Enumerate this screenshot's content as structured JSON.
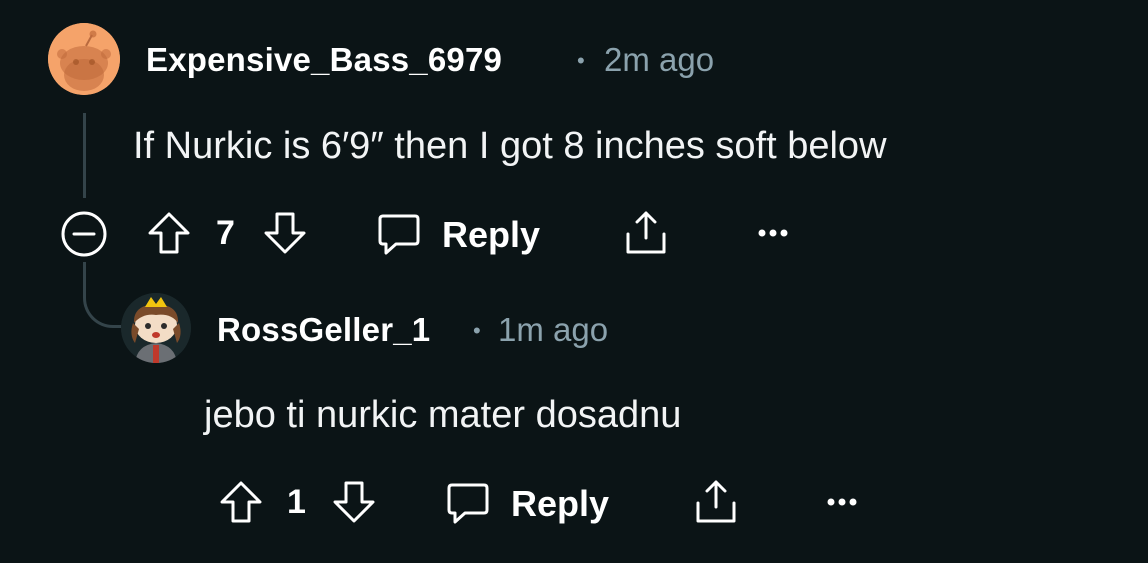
{
  "comments": [
    {
      "username": "Expensive_Bass_6979",
      "separator": "•",
      "time": "2m ago",
      "text": "If Nurkic is 6′9″ then I got 8 inches soft below",
      "votes": "7",
      "reply_label": "Reply",
      "avatar": "snoo-avatar-orange",
      "icons": [
        "collapse-icon",
        "upvote-icon",
        "downvote-icon",
        "reply-icon",
        "share-icon",
        "more-icon"
      ]
    },
    {
      "username": "RossGeller_1",
      "separator": "•",
      "time": "1m ago",
      "text": "jebo ti nurkic mater dosadnu",
      "votes": "1",
      "reply_label": "Reply",
      "avatar": "snoo-avatar-custom",
      "icons": [
        "upvote-icon",
        "downvote-icon",
        "reply-icon",
        "share-icon",
        "more-icon"
      ]
    }
  ],
  "colors": {
    "background": "#0b1416",
    "text": "#ffffff",
    "meta": "#8ba2ad",
    "thread_line": "#34444a",
    "avatar_orange": "#f5a36a"
  }
}
